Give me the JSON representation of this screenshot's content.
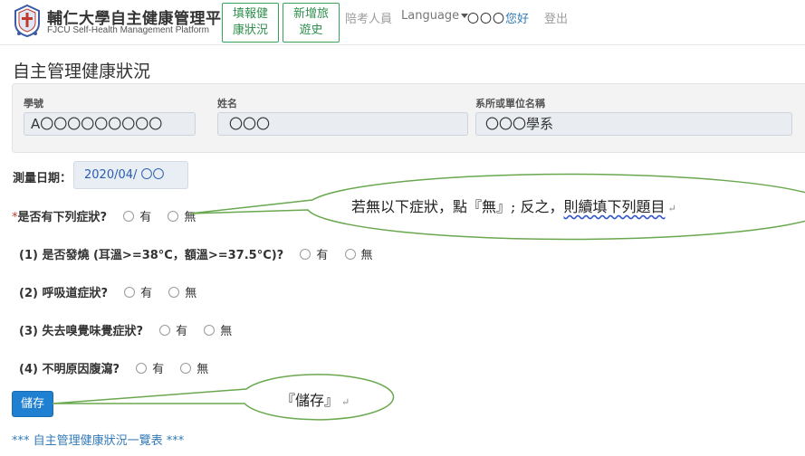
{
  "header": {
    "title": "輔仁大學自主健康管理平台",
    "subtitle": "FJCU Self-Health Management Platform",
    "nav": {
      "fill_health": [
        "填報健",
        "康狀況"
      ],
      "add_travel": [
        "新增旅",
        "遊史"
      ],
      "companion": "陪考人員",
      "language": "Language",
      "user_name": "〇〇〇",
      "greeting": "您好",
      "logout": "登出"
    }
  },
  "page_title": "自主管理健康狀況",
  "info": {
    "student_id_label": "學號",
    "student_id_value": "A〇〇〇〇〇〇〇〇〇",
    "name_label": "姓名",
    "name_value": "〇〇〇",
    "dept_label": "系所或單位名稱",
    "dept_value": "〇〇〇學系"
  },
  "date": {
    "label": "測量日期：",
    "value": "2020/04/ 〇〇"
  },
  "questions": {
    "q0": {
      "required": "*",
      "label": "是否有下列症狀?",
      "yes": "有",
      "no": "無"
    },
    "q1": {
      "label": "(1) 是否發燒 (耳溫>=38°C，額溫>=37.5°C)?",
      "yes": "有",
      "no": "無"
    },
    "q2": {
      "label": "(2) 呼吸道症狀?",
      "yes": "有",
      "no": "無"
    },
    "q3": {
      "label": "(3) 失去嗅覺味覺症狀?",
      "yes": "有",
      "no": "無"
    },
    "q4": {
      "label": "(4) 不明原因腹瀉?",
      "yes": "有",
      "no": "無"
    }
  },
  "save_label": "儲存",
  "list_link": "*** 自主管理健康狀況一覽表 ***",
  "callouts": {
    "symptom_tip_a": "若無以下症狀，點『無』; 反之，",
    "symptom_tip_b": "則續填下列題目",
    "save_tip": "『儲存』",
    "pilcrow": "↵"
  },
  "colors": {
    "nav_border": "#3aa35a",
    "link": "#337ab7",
    "primary": "#1f7fd1",
    "callout_stroke": "#6aa84f"
  }
}
